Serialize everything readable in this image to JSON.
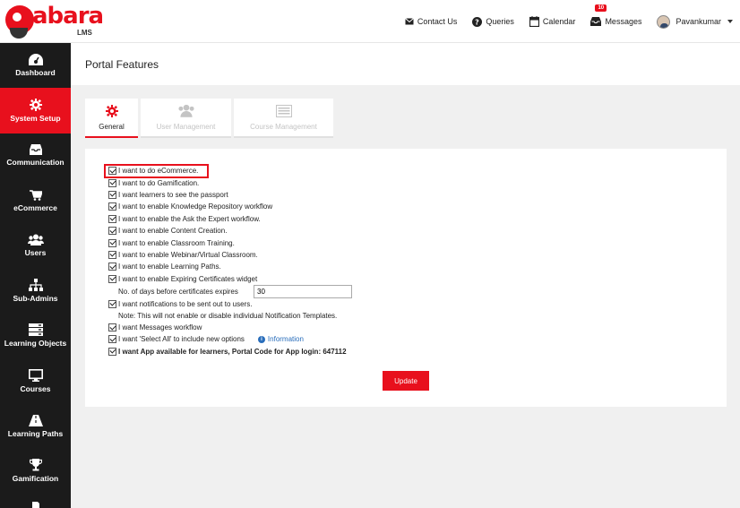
{
  "logo": {
    "text": "abara",
    "sub": "LMS"
  },
  "topnav": {
    "contact": "Contact Us",
    "queries": "Queries",
    "calendar": "Calendar",
    "messages": "Messages",
    "messages_count": "10",
    "user": "Pavankumar"
  },
  "sidebar": {
    "items": [
      {
        "label": "Dashboard",
        "icon": "dashboard-icon"
      },
      {
        "label": "System Setup",
        "icon": "gear-icon",
        "active": true
      },
      {
        "label": "Communication",
        "icon": "inbox-icon"
      },
      {
        "label": "eCommerce",
        "icon": "cart-icon"
      },
      {
        "label": "Users",
        "icon": "users-icon"
      },
      {
        "label": "Sub-Admins",
        "icon": "sitemap-icon"
      },
      {
        "label": "Learning Objects",
        "icon": "stack-icon"
      },
      {
        "label": "Courses",
        "icon": "monitor-icon"
      },
      {
        "label": "Learning Paths",
        "icon": "road-icon"
      },
      {
        "label": "Gamification",
        "icon": "trophy-icon"
      }
    ]
  },
  "page": {
    "title": "Portal Features"
  },
  "tabs": [
    {
      "label": "General",
      "active": true
    },
    {
      "label": "User Management",
      "active": false
    },
    {
      "label": "Course Management",
      "active": false
    }
  ],
  "options": [
    "I want to do eCommerce.",
    "I want to do Gamification.",
    "I want learners to see the passport",
    "I want to enable Knowledge Repository workflow",
    "I want to enable the Ask the Expert workflow.",
    "I want to enable Content Creation.",
    "I want to enable Classroom Training.",
    "I want to enable Webinar/Virtual Classroom.",
    "I want to enable Learning Paths.",
    "I want to enable Expiring Certificates widget"
  ],
  "cert_days": {
    "label": "No. of days before certificates expires",
    "value": "30"
  },
  "notifications": {
    "label": "I want notifications to be sent out to users.",
    "note": "Note: This will not enable or disable individual Notification Templates."
  },
  "more_options": {
    "messages": "I want Messages workflow",
    "select_all": "I want 'Select All' to include new options",
    "information": "Information",
    "app": "I want App available for learners, Portal Code for App login: 647112"
  },
  "update_label": "Update",
  "colors": {
    "accent": "#e8101d",
    "sidebar": "#1b1b1b",
    "link": "#2a6ebb"
  }
}
